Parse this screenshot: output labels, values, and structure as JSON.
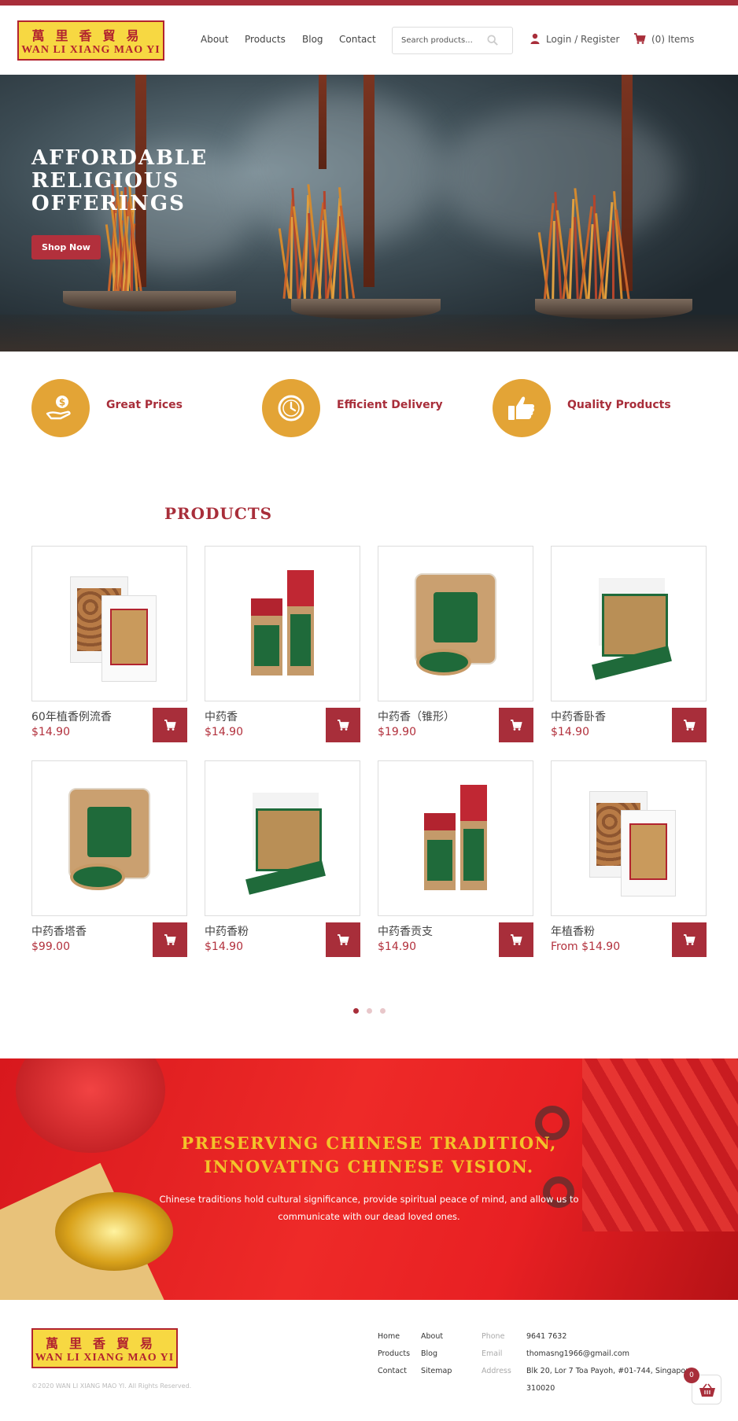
{
  "brand": {
    "logo_chinese": "萬里香貿易",
    "logo_english": "WAN LI XIANG MAO YI"
  },
  "nav": {
    "items": [
      "About",
      "Products",
      "Blog",
      "Contact"
    ],
    "search_placeholder": "Search products...",
    "login_label": "Login / Register",
    "cart_label": "(0) Items"
  },
  "hero": {
    "title_lines": [
      "AFFORDABLE",
      "RELIGIOUS",
      "OFFERINGS"
    ],
    "button_label": "Shop Now"
  },
  "features": [
    {
      "label": "Great Prices",
      "icon": "money-hand-icon"
    },
    {
      "label": "Efficient Delivery",
      "icon": "clock-icon"
    },
    {
      "label": "Quality Products",
      "icon": "thumbs-up-icon"
    }
  ],
  "products_section": {
    "title": "PRODUCTS",
    "items": [
      {
        "name": "60年植香例流香",
        "price": "$14.90"
      },
      {
        "name": "中药香",
        "price": "$14.90"
      },
      {
        "name": "中药香（锥形）",
        "price": "$19.90"
      },
      {
        "name": "中药香卧香",
        "price": "$14.90"
      },
      {
        "name": "中药香塔香",
        "price": "$99.00"
      },
      {
        "name": "中药香粉",
        "price": "$14.90"
      },
      {
        "name": "中药香贡支",
        "price": "$14.90"
      },
      {
        "name": "年植香粉",
        "price": "From $14.90"
      }
    ],
    "pagination": {
      "pages": 3,
      "active": 1
    }
  },
  "banner": {
    "title_lines": [
      "PRESERVING CHINESE TRADITION,",
      "INNOVATING CHINESE VISION."
    ],
    "text_lines": [
      "Chinese traditions hold cultural significance, provide spiritual peace of mind, and allow us to",
      "communicate with our dead loved ones."
    ]
  },
  "footer": {
    "copyright": "©2020 WAN LI XIANG MAO YI. All Rights Reserved.",
    "links_col1": [
      "Home",
      "Products",
      "Contact"
    ],
    "links_col2": [
      "About",
      "Blog",
      "Sitemap"
    ],
    "contact": {
      "phone_label": "Phone",
      "phone": "9641 7632",
      "email_label": "Email",
      "email": "thomasng1966@gmail.com",
      "address_label": "Address",
      "address_line1": "Blk 20, Lor 7 Toa Payoh, #01-744, Singapore",
      "address_line2": "310020"
    },
    "cart_badge": "0"
  },
  "colors": {
    "brand_red": "#a82e3a",
    "accent_gold": "#e3a436",
    "logo_yellow": "#f7d842"
  }
}
